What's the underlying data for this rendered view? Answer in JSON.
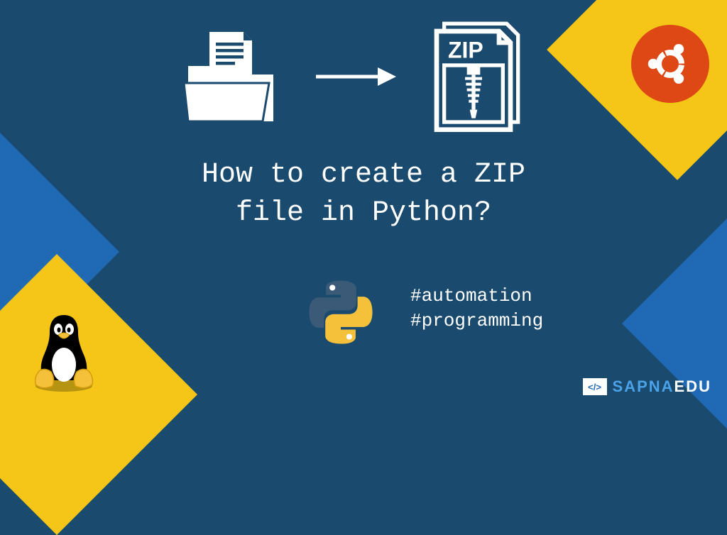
{
  "headline_line1": "How to create a ZIP",
  "headline_line2": "file in Python?",
  "hashtag1": "#automation",
  "hashtag2": "#programming",
  "zip_label": "ZIP",
  "brand": {
    "icon_text": "</>",
    "part1": "SAPNA",
    "part2": "EDU"
  },
  "colors": {
    "bg": "#1a4a6e",
    "yellow": "#f5c518",
    "blue": "#2069b4",
    "ubuntu": "#dd4814"
  }
}
